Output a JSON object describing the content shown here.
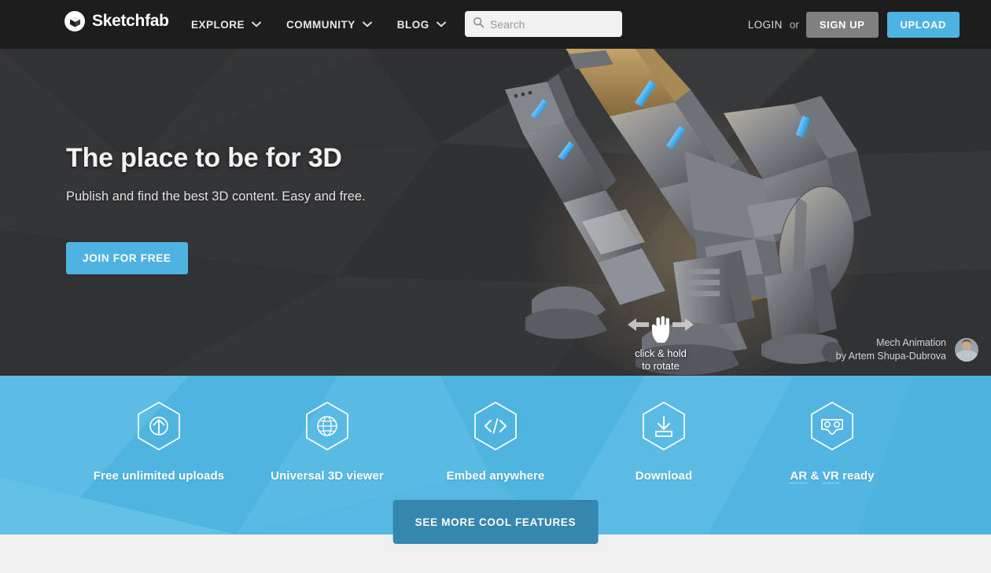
{
  "header": {
    "brand": "Sketchfab",
    "logo_icon": "cube-logo-icon",
    "nav": [
      {
        "label": "EXPLORE",
        "icon": "chevron-down-icon"
      },
      {
        "label": "COMMUNITY",
        "icon": "chevron-down-icon"
      },
      {
        "label": "BLOG",
        "icon": "chevron-down-icon"
      }
    ],
    "search": {
      "icon": "search-icon",
      "placeholder": "Search",
      "value": ""
    },
    "login_label": "LOGIN",
    "or_label": "or",
    "signup_label": "SIGN UP",
    "upload_label": "UPLOAD"
  },
  "hero": {
    "title": "The place to be for 3D",
    "subtitle": "Publish and find the best 3D content. Easy and free.",
    "cta_label": "JOIN FOR FREE",
    "rotate_hint_line1": "click & hold",
    "rotate_hint_line2": "to rotate",
    "rotate_hint_icon": "pointing-hand-icon",
    "model_name": "Mech Animation",
    "model_author": "by Artem Shupa-Dubrova",
    "avatar_icon": "user-avatar"
  },
  "features": {
    "items": [
      {
        "label": "Free unlimited uploads",
        "icon": "upload-arrow-hexagon-icon"
      },
      {
        "label": "Universal 3D viewer",
        "icon": "globe-hexagon-icon"
      },
      {
        "label": "Embed anywhere",
        "icon": "code-brackets-hexagon-icon"
      },
      {
        "label": "Download",
        "icon": "download-hexagon-icon"
      },
      {
        "label": "AR & VR ready",
        "icon": "vr-goggles-hexagon-icon"
      }
    ],
    "ar_abbr": "AR",
    "vr_abbr": "VR",
    "ar_vr_suffix": " ready",
    "ampersand": " & ",
    "cta_label": "SEE MORE COOL FEATURES"
  },
  "colors": {
    "header_bg": "#1d1d1d",
    "hero_bg": "#333436",
    "accent_blue": "#4eb3e0",
    "band_blue": "#53b7e2",
    "cta_dark_blue": "#3687b0",
    "signup_gray": "#808080",
    "page_bg": "#f0f0f0"
  }
}
